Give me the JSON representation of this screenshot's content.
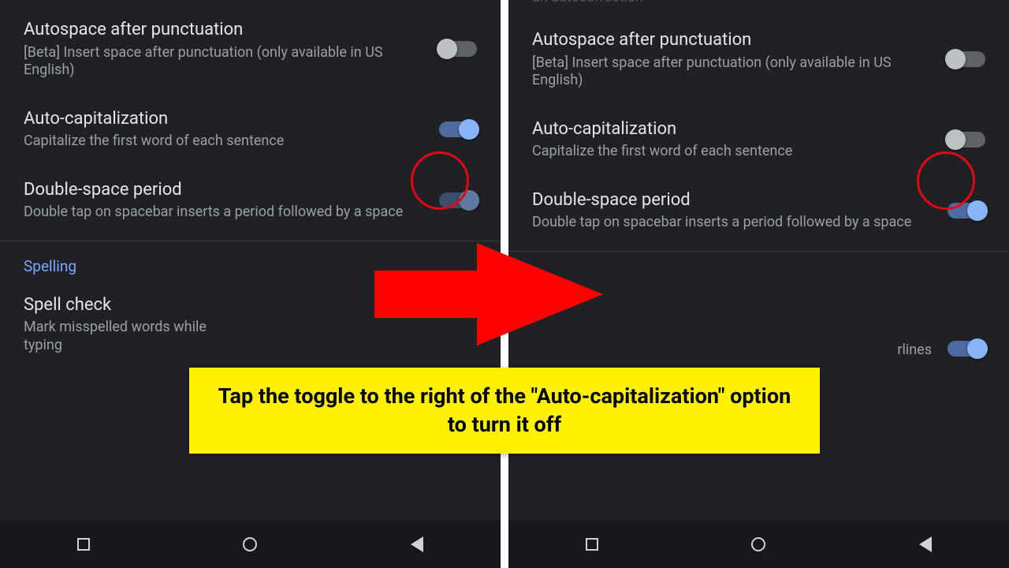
{
  "left": {
    "items": {
      "autospace": {
        "title": "Autospace after punctuation",
        "sub": "[Beta] Insert space after punctuation (only available in US English)",
        "on": false
      },
      "autocap": {
        "title": "Auto-capitalization",
        "sub": "Capitalize the first word of each sentence",
        "on": true
      },
      "doublespace": {
        "title": "Double-space period",
        "sub": "Double tap on spacebar inserts a period followed by a space",
        "on": true
      },
      "spelling_header": "Spelling",
      "spellcheck": {
        "title": "Spell check",
        "sub": "Mark misspelled words while typing"
      }
    }
  },
  "right": {
    "clip_top": "an autocorrection",
    "items": {
      "autospace": {
        "title": "Autospace after punctuation",
        "sub": "[Beta] Insert space after punctuation (only available in US English)",
        "on": false
      },
      "autocap": {
        "title": "Auto-capitalization",
        "sub": "Capitalize the first word of each sentence",
        "on": false
      },
      "doublespace": {
        "title": "Double-space period",
        "sub": "Double tap on spacebar inserts a period followed by a space",
        "on": true
      },
      "spellcheck_tail": "rlines",
      "spellcheck_on": true
    }
  },
  "annotation": {
    "text": "Tap the toggle to the right of the \"Auto-capitalization\" option to turn it off"
  },
  "colors": {
    "accent_on": "#8ab4f8",
    "highlight": "#e30613",
    "callout_bg": "#fff100"
  }
}
